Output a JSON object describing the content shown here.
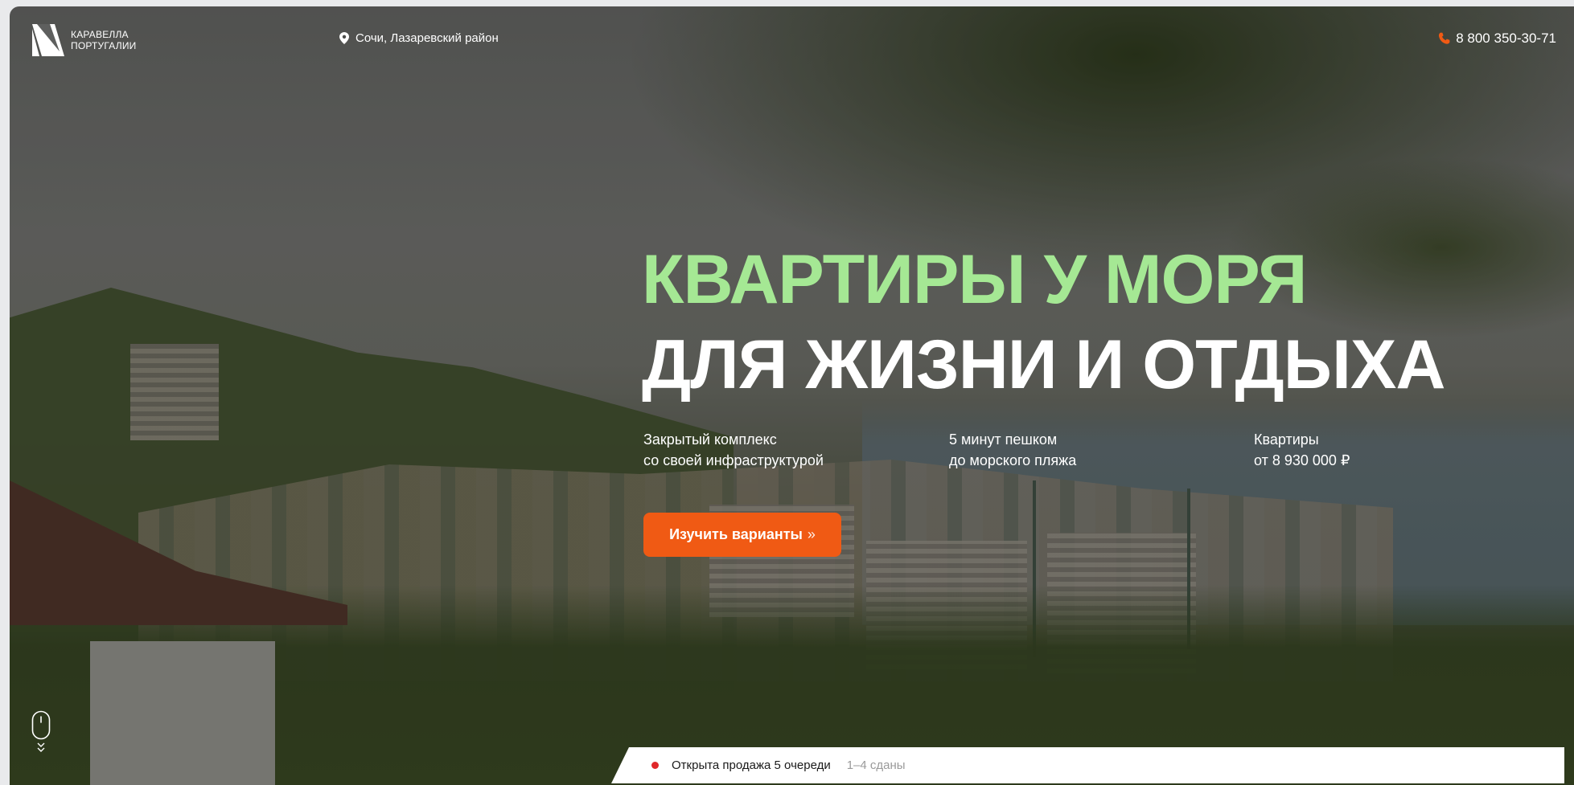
{
  "header": {
    "logo_line1": "КАРАВЕЛЛА",
    "logo_line2": "ПОРТУГАЛИИ",
    "location": "Сочи, Лазаревский район",
    "phone": "8 800 350-30-71"
  },
  "hero": {
    "title_line1": "КВАРТИРЫ У МОРЯ",
    "title_line2": "ДЛЯ ЖИЗНИ И ОТДЫХА",
    "features": [
      {
        "line1": "Закрытый комплекс",
        "line2": "со своей инфраструктурой"
      },
      {
        "line1": "5 минут пешком",
        "line2": "до морского пляжа"
      },
      {
        "line1": "Квартиры",
        "line2": "от 8 930 000 ₽"
      }
    ],
    "cta_label": "Изучить варианты",
    "cta_arrow": "»"
  },
  "status": {
    "main": "Открыта продажа 5 очереди",
    "sub": "1–4 сданы"
  },
  "colors": {
    "accent": "#f05a14",
    "title_green": "#a5e894",
    "status_dot": "#e0282a"
  },
  "icons": {
    "logo": "logo-mark",
    "location": "location-pin-icon",
    "phone": "phone-icon",
    "scroll": "mouse-scroll-icon"
  }
}
